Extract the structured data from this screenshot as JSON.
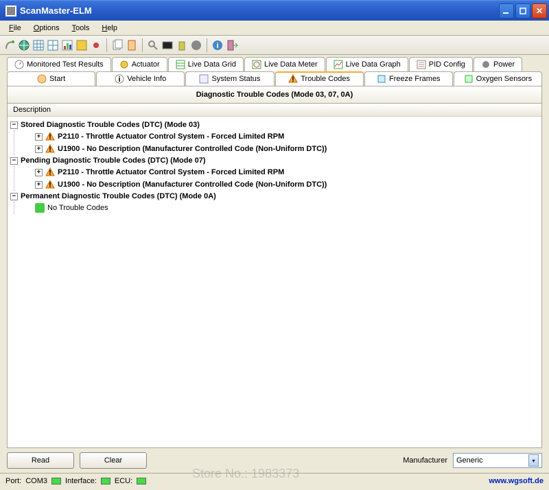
{
  "window": {
    "title": "ScanMaster-ELM"
  },
  "menu": {
    "file": "File",
    "options": "Options",
    "tools": "Tools",
    "help": "Help"
  },
  "tabs_row1": [
    {
      "label": "Monitored Test Results"
    },
    {
      "label": "Actuator"
    },
    {
      "label": "Live Data Grid"
    },
    {
      "label": "Live Data Meter"
    },
    {
      "label": "Live Data Graph"
    },
    {
      "label": "PID Config"
    },
    {
      "label": "Power"
    }
  ],
  "tabs_row2": [
    {
      "label": "Start"
    },
    {
      "label": "Vehicle Info"
    },
    {
      "label": "System Status"
    },
    {
      "label": "Trouble Codes"
    },
    {
      "label": "Freeze Frames"
    },
    {
      "label": "Oxygen Sensors"
    }
  ],
  "panel": {
    "title": "Diagnostic Trouble Codes (Mode 03, 07, 0A)",
    "desc_header": "Description"
  },
  "tree": {
    "stored": {
      "label": "Stored Diagnostic Trouble Codes (DTC) (Mode 03)",
      "items": [
        "P2110 - Throttle Actuator Control System - Forced Limited RPM",
        "U1900 - No Description (Manufacturer Controlled Code (Non-Uniform DTC))"
      ]
    },
    "pending": {
      "label": "Pending Diagnostic Trouble Codes (DTC) (Mode 07)",
      "items": [
        "P2110 - Throttle Actuator Control System - Forced Limited RPM",
        "U1900 - No Description (Manufacturer Controlled Code (Non-Uniform DTC))"
      ]
    },
    "permanent": {
      "label": "Permanent Diagnostic Trouble Codes (DTC) (Mode 0A)",
      "none": "No Trouble Codes"
    }
  },
  "buttons": {
    "read": "Read",
    "clear": "Clear"
  },
  "manufacturer": {
    "label": "Manufacturer",
    "value": "Generic"
  },
  "status": {
    "port": "Port:",
    "portval": "COM3",
    "iface": "Interface:",
    "ecu": "ECU:",
    "link": "www.wgsoft.de"
  },
  "watermark": "Store No.: 1983373"
}
